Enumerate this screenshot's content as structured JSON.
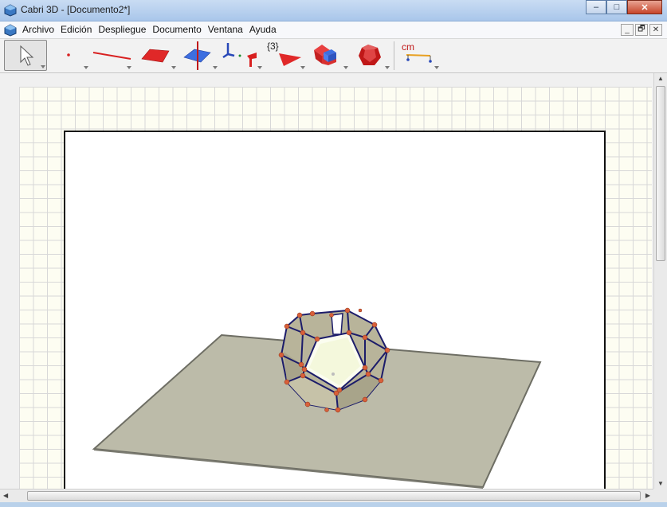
{
  "window": {
    "title": "Cabri 3D - [Documento2*]",
    "controls": [
      "–",
      "□",
      "✕"
    ]
  },
  "menubar": {
    "items": [
      "Archivo",
      "Edición",
      "Despliegue",
      "Documento",
      "Ventana",
      "Ayuda"
    ],
    "mdi_controls": [
      "_",
      "🗗",
      "✕"
    ]
  },
  "toolbar": {
    "tools": [
      {
        "name": "pointer-tool",
        "icon": "arrow-pointer-icon"
      },
      {
        "name": "points-tool",
        "icon": "point-icon"
      },
      {
        "name": "curves-tool",
        "icon": "line-icon"
      },
      {
        "name": "surfaces-tool",
        "icon": "plane-icon"
      },
      {
        "name": "relative-constructions-tool",
        "icon": "perpendicular-icon"
      },
      {
        "name": "transformations-tool",
        "icon": "symmetry-icon"
      },
      {
        "name": "regular-polygons-tool",
        "icon": "triangle-icon",
        "label": "{3}"
      },
      {
        "name": "solids-tool",
        "icon": "cube-icon"
      },
      {
        "name": "regular-polyhedra-tool",
        "icon": "dodecahedron-icon"
      },
      {
        "name": "measurement-tool",
        "icon": "measure-icon",
        "label": "cm"
      }
    ]
  },
  "colors": {
    "accent_red": "#d82020",
    "plane_gray": "#bcbba9",
    "edge_blue": "#1c1c6a",
    "vertex_orange": "#d8603a",
    "face_khaki": "#b8b49a"
  }
}
